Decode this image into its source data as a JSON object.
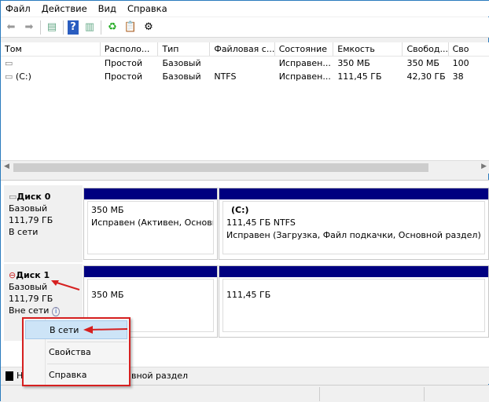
{
  "menu": [
    "Файл",
    "Действие",
    "Вид",
    "Справка"
  ],
  "toolbar": [
    "back-icon",
    "forward-icon",
    "console-tree-icon",
    "help-icon",
    "action-pane-icon",
    "refresh-icon",
    "properties-icon",
    "settings-icon"
  ],
  "table": {
    "headers": [
      "Том",
      "Располо...",
      "Тип",
      "Файловая с...",
      "Состояние",
      "Емкость",
      "Свобод...",
      "Сво"
    ],
    "rows": [
      [
        "",
        "Простой",
        "Базовый",
        "",
        "Исправен...",
        "350 МБ",
        "350 МБ",
        "100"
      ],
      [
        "(C:)",
        "Простой",
        "Базовый",
        "NTFS",
        "Исправен...",
        "111,45 ГБ",
        "42,30 ГБ",
        "38"
      ]
    ]
  },
  "disks": [
    {
      "name": "Диск 0",
      "type": "Базовый",
      "size": "111,79 ГБ",
      "status": "В сети",
      "partitions": [
        {
          "title": "",
          "size": "350 МБ",
          "state": "Исправен (Активен, Основн"
        },
        {
          "title": "(C:)",
          "size": "111,45 ГБ NTFS",
          "state": "Исправен (Загрузка, Файл подкачки, Основной раздел)"
        }
      ]
    },
    {
      "name": "Диск 1",
      "type": "Базовый",
      "size": "111,79 ГБ",
      "status": "Вне сети",
      "partitions": [
        {
          "size": "350 МБ"
        },
        {
          "size": "111,45 ГБ"
        }
      ]
    }
  ],
  "legend": {
    "item1": "Н",
    "item2": "вной раздел",
    "colors": {
      "unallocated": "#000000",
      "primary": "#000080"
    }
  },
  "context_menu": {
    "items": [
      "В сети",
      "Свойства",
      "Справка"
    ],
    "highlighted": "В сети"
  },
  "colors": {
    "partition_bar": "#000080",
    "annotation": "#d62020"
  }
}
